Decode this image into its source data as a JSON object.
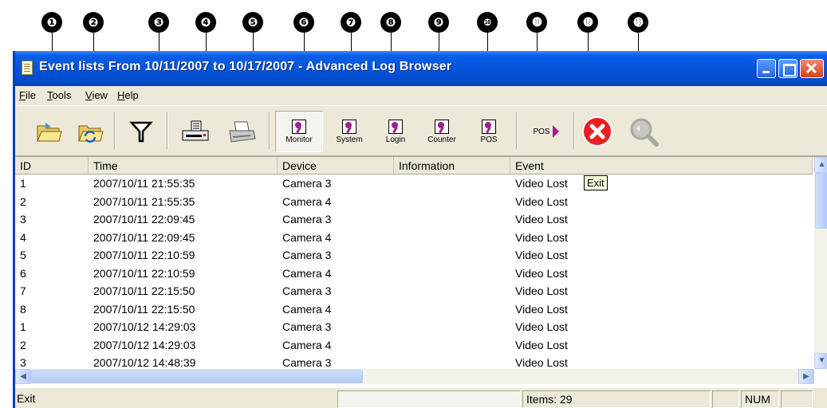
{
  "callouts": [
    "❶",
    "❷",
    "❸",
    "❹",
    "❺",
    "❻",
    "❼",
    "❽",
    "❾",
    "❿",
    "⓫",
    "⓬",
    "⓭"
  ],
  "window": {
    "title": "Event lists From 10/11/2007 to 10/17/2007 - Advanced Log Browser"
  },
  "menu": {
    "file": [
      "F",
      "ile"
    ],
    "tools": [
      "T",
      "ools"
    ],
    "view": [
      "V",
      "iew"
    ],
    "help": [
      "H",
      "elp"
    ]
  },
  "toolbar": {
    "monitor": "Monitor",
    "system": "System",
    "login": "Login",
    "counter": "Counter",
    "pos": "POS",
    "pos_button": "POS"
  },
  "columns": [
    "ID",
    "Time",
    "Device",
    "Information",
    "Event"
  ],
  "rows": [
    {
      "id": "1",
      "time": "2007/10/11 21:55:35",
      "device": "Camera 3",
      "info": "",
      "event": "Video Lost"
    },
    {
      "id": "2",
      "time": "2007/10/11 21:55:35",
      "device": "Camera 4",
      "info": "",
      "event": "Video Lost"
    },
    {
      "id": "3",
      "time": "2007/10/11 22:09:45",
      "device": "Camera 3",
      "info": "",
      "event": "Video Lost"
    },
    {
      "id": "4",
      "time": "2007/10/11 22:09:45",
      "device": "Camera 4",
      "info": "",
      "event": "Video Lost"
    },
    {
      "id": "5",
      "time": "2007/10/11 22:10:59",
      "device": "Camera 3",
      "info": "",
      "event": "Video Lost"
    },
    {
      "id": "6",
      "time": "2007/10/11 22:10:59",
      "device": "Camera 4",
      "info": "",
      "event": "Video Lost"
    },
    {
      "id": "7",
      "time": "2007/10/11 22:15:50",
      "device": "Camera 3",
      "info": "",
      "event": "Video Lost"
    },
    {
      "id": "8",
      "time": "2007/10/11 22:15:50",
      "device": "Camera 4",
      "info": "",
      "event": "Video Lost"
    },
    {
      "id": "1",
      "time": "2007/10/12 14:29:03",
      "device": "Camera 3",
      "info": "",
      "event": "Video Lost"
    },
    {
      "id": "2",
      "time": "2007/10/12 14:29:03",
      "device": "Camera 4",
      "info": "",
      "event": "Video Lost"
    },
    {
      "id": "3",
      "time": "2007/10/12 14:48:39",
      "device": "Camera 3",
      "info": "",
      "event": "Video Lost"
    }
  ],
  "tooltip": "Exit",
  "status": {
    "text": "Exit",
    "items": "Items: 29",
    "num": "NUM"
  }
}
